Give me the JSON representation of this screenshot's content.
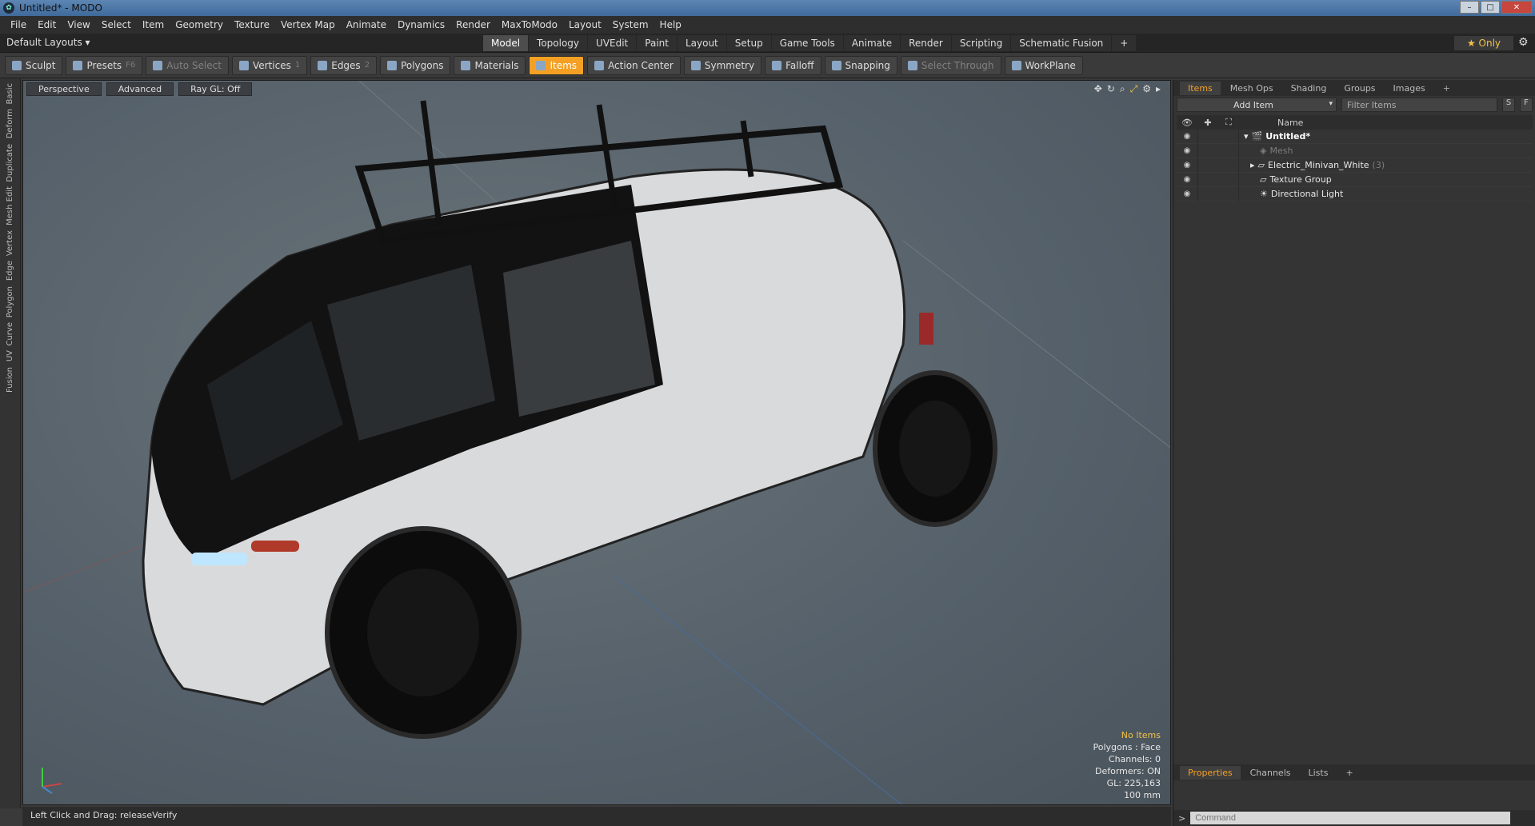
{
  "window": {
    "title": "Untitled* - MODO",
    "app_icon": "modo-icon",
    "buttons": [
      "–",
      "□",
      "✕"
    ]
  },
  "menu": [
    "File",
    "Edit",
    "View",
    "Select",
    "Item",
    "Geometry",
    "Texture",
    "Vertex Map",
    "Animate",
    "Dynamics",
    "Render",
    "MaxToModo",
    "Layout",
    "System",
    "Help"
  ],
  "layouts": {
    "label": "Default Layouts ▾",
    "tabs": [
      "Model",
      "Topology",
      "UVEdit",
      "Paint",
      "Layout",
      "Setup",
      "Game Tools",
      "Animate",
      "Render",
      "Scripting",
      "Schematic Fusion",
      "+"
    ],
    "active_tab": "Model",
    "only": "★ Only"
  },
  "toolbar": {
    "sculpt": "Sculpt",
    "presets": "Presets",
    "presets_key": "F6",
    "auto_select": "Auto Select",
    "vertices": "Vertices",
    "vertices_key": "1",
    "edges": "Edges",
    "edges_key": "2",
    "polygons": "Polygons",
    "materials": "Materials",
    "items": "Items",
    "action_center": "Action Center",
    "symmetry": "Symmetry",
    "falloff": "Falloff",
    "snapping": "Snapping",
    "select_through": "Select Through",
    "workplane": "WorkPlane"
  },
  "left_tabs": [
    "Basic",
    "Deform",
    "Duplicate",
    "Mesh Edit",
    "Vertex",
    "Edge",
    "Polygon",
    "Curve",
    "UV",
    "Fusion"
  ],
  "viewport": {
    "buttons": [
      "Perspective",
      "Advanced",
      "Ray GL: Off"
    ],
    "info": {
      "selection": "No Items",
      "polygons": "Polygons : Face",
      "channels": "Channels: 0",
      "deformers": "Deformers: ON",
      "gl": "GL: 225,163",
      "scale": "100 mm"
    }
  },
  "status": "Left Click and Drag:   releaseVerify",
  "items_panel": {
    "tabs": [
      "Items",
      "Mesh Ops",
      "Shading",
      "Groups",
      "Images",
      "+"
    ],
    "add_item": "Add Item",
    "filter": "Filter Items",
    "btn_s": "S",
    "btn_f": "F",
    "header_name": "Name",
    "tree": [
      {
        "label": "Untitled*",
        "expander": "▾",
        "icon": "scene-icon",
        "bold": true
      },
      {
        "label": "Mesh",
        "icon": "mesh-icon",
        "dim": true
      },
      {
        "label": "Electric_Minivan_White",
        "count": "(3)",
        "expander": "▸",
        "icon": "group-icon"
      },
      {
        "label": "Texture Group",
        "icon": "texture-group-icon"
      },
      {
        "label": "Directional Light",
        "icon": "light-icon"
      }
    ]
  },
  "properties_panel": {
    "tabs": [
      "Properties",
      "Channels",
      "Lists",
      "+"
    ],
    "command_placeholder": "Command"
  }
}
